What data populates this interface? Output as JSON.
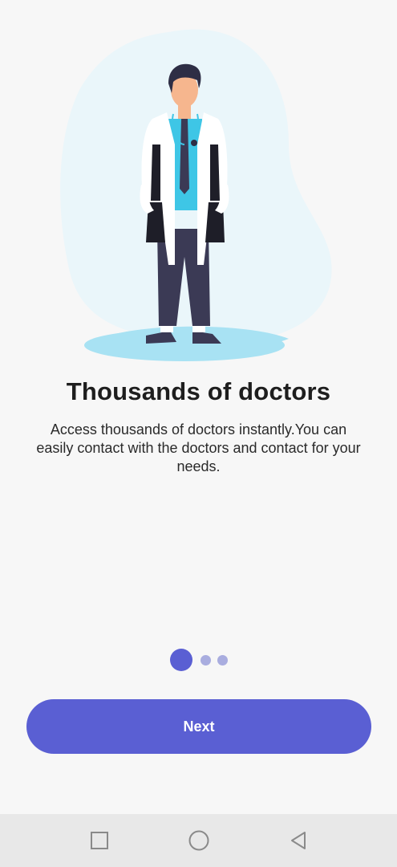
{
  "onboarding": {
    "title": "Thousands of doctors",
    "description": "Access thousands of doctors instantly.You can easily contact with the doctors and contact for your needs.",
    "page_indicator": {
      "total": 3,
      "current": 1
    },
    "next_label": "Next"
  },
  "illustration": {
    "icon": "doctor-illustration",
    "colors": {
      "blob": "#eaf6fa",
      "shadow": "#a8e2f3",
      "coat": "#ffffff",
      "shirt": "#3ec6e6",
      "pants": "#3b3a55",
      "skin": "#f6b68e",
      "hair": "#2e2e45"
    }
  },
  "navigation_bar": {
    "icons": [
      "recents-square-icon",
      "home-circle-icon",
      "back-triangle-icon"
    ]
  },
  "colors": {
    "accent": "#5a5fd3",
    "accent_light": "#a9addf",
    "background": "#f7f7f7",
    "text": "#1e1e1e"
  }
}
